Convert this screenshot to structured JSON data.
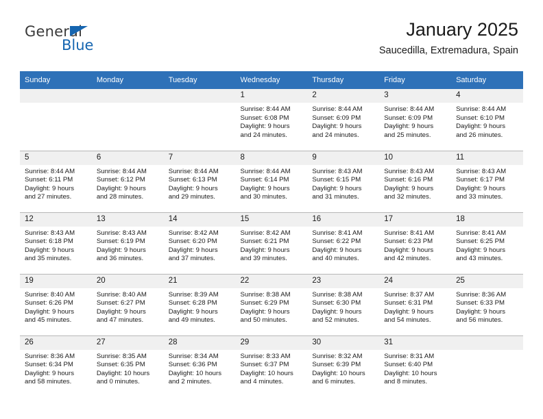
{
  "logo": {
    "word_top": "General",
    "word_bottom": "Blue",
    "triangle_color": "#1565b0",
    "text_color": "#3a3a3a"
  },
  "header": {
    "title": "January 2025",
    "subtitle": "Saucedilla, Extremadura, Spain"
  },
  "theme": {
    "header_blue": "#2e71b8",
    "daynum_band": "#f0f0f0",
    "grid_line": "#b7b7b7"
  },
  "weekday_headers": [
    "Sunday",
    "Monday",
    "Tuesday",
    "Wednesday",
    "Thursday",
    "Friday",
    "Saturday"
  ],
  "weeks": [
    [
      {
        "day": "",
        "sunrise": "",
        "sunset": "",
        "daylight_line1": "",
        "daylight_line2": ""
      },
      {
        "day": "",
        "sunrise": "",
        "sunset": "",
        "daylight_line1": "",
        "daylight_line2": ""
      },
      {
        "day": "",
        "sunrise": "",
        "sunset": "",
        "daylight_line1": "",
        "daylight_line2": ""
      },
      {
        "day": "1",
        "sunrise": "Sunrise: 8:44 AM",
        "sunset": "Sunset: 6:08 PM",
        "daylight_line1": "Daylight: 9 hours",
        "daylight_line2": "and 24 minutes."
      },
      {
        "day": "2",
        "sunrise": "Sunrise: 8:44 AM",
        "sunset": "Sunset: 6:09 PM",
        "daylight_line1": "Daylight: 9 hours",
        "daylight_line2": "and 24 minutes."
      },
      {
        "day": "3",
        "sunrise": "Sunrise: 8:44 AM",
        "sunset": "Sunset: 6:09 PM",
        "daylight_line1": "Daylight: 9 hours",
        "daylight_line2": "and 25 minutes."
      },
      {
        "day": "4",
        "sunrise": "Sunrise: 8:44 AM",
        "sunset": "Sunset: 6:10 PM",
        "daylight_line1": "Daylight: 9 hours",
        "daylight_line2": "and 26 minutes."
      }
    ],
    [
      {
        "day": "5",
        "sunrise": "Sunrise: 8:44 AM",
        "sunset": "Sunset: 6:11 PM",
        "daylight_line1": "Daylight: 9 hours",
        "daylight_line2": "and 27 minutes."
      },
      {
        "day": "6",
        "sunrise": "Sunrise: 8:44 AM",
        "sunset": "Sunset: 6:12 PM",
        "daylight_line1": "Daylight: 9 hours",
        "daylight_line2": "and 28 minutes."
      },
      {
        "day": "7",
        "sunrise": "Sunrise: 8:44 AM",
        "sunset": "Sunset: 6:13 PM",
        "daylight_line1": "Daylight: 9 hours",
        "daylight_line2": "and 29 minutes."
      },
      {
        "day": "8",
        "sunrise": "Sunrise: 8:44 AM",
        "sunset": "Sunset: 6:14 PM",
        "daylight_line1": "Daylight: 9 hours",
        "daylight_line2": "and 30 minutes."
      },
      {
        "day": "9",
        "sunrise": "Sunrise: 8:43 AM",
        "sunset": "Sunset: 6:15 PM",
        "daylight_line1": "Daylight: 9 hours",
        "daylight_line2": "and 31 minutes."
      },
      {
        "day": "10",
        "sunrise": "Sunrise: 8:43 AM",
        "sunset": "Sunset: 6:16 PM",
        "daylight_line1": "Daylight: 9 hours",
        "daylight_line2": "and 32 minutes."
      },
      {
        "day": "11",
        "sunrise": "Sunrise: 8:43 AM",
        "sunset": "Sunset: 6:17 PM",
        "daylight_line1": "Daylight: 9 hours",
        "daylight_line2": "and 33 minutes."
      }
    ],
    [
      {
        "day": "12",
        "sunrise": "Sunrise: 8:43 AM",
        "sunset": "Sunset: 6:18 PM",
        "daylight_line1": "Daylight: 9 hours",
        "daylight_line2": "and 35 minutes."
      },
      {
        "day": "13",
        "sunrise": "Sunrise: 8:43 AM",
        "sunset": "Sunset: 6:19 PM",
        "daylight_line1": "Daylight: 9 hours",
        "daylight_line2": "and 36 minutes."
      },
      {
        "day": "14",
        "sunrise": "Sunrise: 8:42 AM",
        "sunset": "Sunset: 6:20 PM",
        "daylight_line1": "Daylight: 9 hours",
        "daylight_line2": "and 37 minutes."
      },
      {
        "day": "15",
        "sunrise": "Sunrise: 8:42 AM",
        "sunset": "Sunset: 6:21 PM",
        "daylight_line1": "Daylight: 9 hours",
        "daylight_line2": "and 39 minutes."
      },
      {
        "day": "16",
        "sunrise": "Sunrise: 8:41 AM",
        "sunset": "Sunset: 6:22 PM",
        "daylight_line1": "Daylight: 9 hours",
        "daylight_line2": "and 40 minutes."
      },
      {
        "day": "17",
        "sunrise": "Sunrise: 8:41 AM",
        "sunset": "Sunset: 6:23 PM",
        "daylight_line1": "Daylight: 9 hours",
        "daylight_line2": "and 42 minutes."
      },
      {
        "day": "18",
        "sunrise": "Sunrise: 8:41 AM",
        "sunset": "Sunset: 6:25 PM",
        "daylight_line1": "Daylight: 9 hours",
        "daylight_line2": "and 43 minutes."
      }
    ],
    [
      {
        "day": "19",
        "sunrise": "Sunrise: 8:40 AM",
        "sunset": "Sunset: 6:26 PM",
        "daylight_line1": "Daylight: 9 hours",
        "daylight_line2": "and 45 minutes."
      },
      {
        "day": "20",
        "sunrise": "Sunrise: 8:40 AM",
        "sunset": "Sunset: 6:27 PM",
        "daylight_line1": "Daylight: 9 hours",
        "daylight_line2": "and 47 minutes."
      },
      {
        "day": "21",
        "sunrise": "Sunrise: 8:39 AM",
        "sunset": "Sunset: 6:28 PM",
        "daylight_line1": "Daylight: 9 hours",
        "daylight_line2": "and 49 minutes."
      },
      {
        "day": "22",
        "sunrise": "Sunrise: 8:38 AM",
        "sunset": "Sunset: 6:29 PM",
        "daylight_line1": "Daylight: 9 hours",
        "daylight_line2": "and 50 minutes."
      },
      {
        "day": "23",
        "sunrise": "Sunrise: 8:38 AM",
        "sunset": "Sunset: 6:30 PM",
        "daylight_line1": "Daylight: 9 hours",
        "daylight_line2": "and 52 minutes."
      },
      {
        "day": "24",
        "sunrise": "Sunrise: 8:37 AM",
        "sunset": "Sunset: 6:31 PM",
        "daylight_line1": "Daylight: 9 hours",
        "daylight_line2": "and 54 minutes."
      },
      {
        "day": "25",
        "sunrise": "Sunrise: 8:36 AM",
        "sunset": "Sunset: 6:33 PM",
        "daylight_line1": "Daylight: 9 hours",
        "daylight_line2": "and 56 minutes."
      }
    ],
    [
      {
        "day": "26",
        "sunrise": "Sunrise: 8:36 AM",
        "sunset": "Sunset: 6:34 PM",
        "daylight_line1": "Daylight: 9 hours",
        "daylight_line2": "and 58 minutes."
      },
      {
        "day": "27",
        "sunrise": "Sunrise: 8:35 AM",
        "sunset": "Sunset: 6:35 PM",
        "daylight_line1": "Daylight: 10 hours",
        "daylight_line2": "and 0 minutes."
      },
      {
        "day": "28",
        "sunrise": "Sunrise: 8:34 AM",
        "sunset": "Sunset: 6:36 PM",
        "daylight_line1": "Daylight: 10 hours",
        "daylight_line2": "and 2 minutes."
      },
      {
        "day": "29",
        "sunrise": "Sunrise: 8:33 AM",
        "sunset": "Sunset: 6:37 PM",
        "daylight_line1": "Daylight: 10 hours",
        "daylight_line2": "and 4 minutes."
      },
      {
        "day": "30",
        "sunrise": "Sunrise: 8:32 AM",
        "sunset": "Sunset: 6:39 PM",
        "daylight_line1": "Daylight: 10 hours",
        "daylight_line2": "and 6 minutes."
      },
      {
        "day": "31",
        "sunrise": "Sunrise: 8:31 AM",
        "sunset": "Sunset: 6:40 PM",
        "daylight_line1": "Daylight: 10 hours",
        "daylight_line2": "and 8 minutes."
      },
      {
        "day": "",
        "sunrise": "",
        "sunset": "",
        "daylight_line1": "",
        "daylight_line2": ""
      }
    ]
  ]
}
